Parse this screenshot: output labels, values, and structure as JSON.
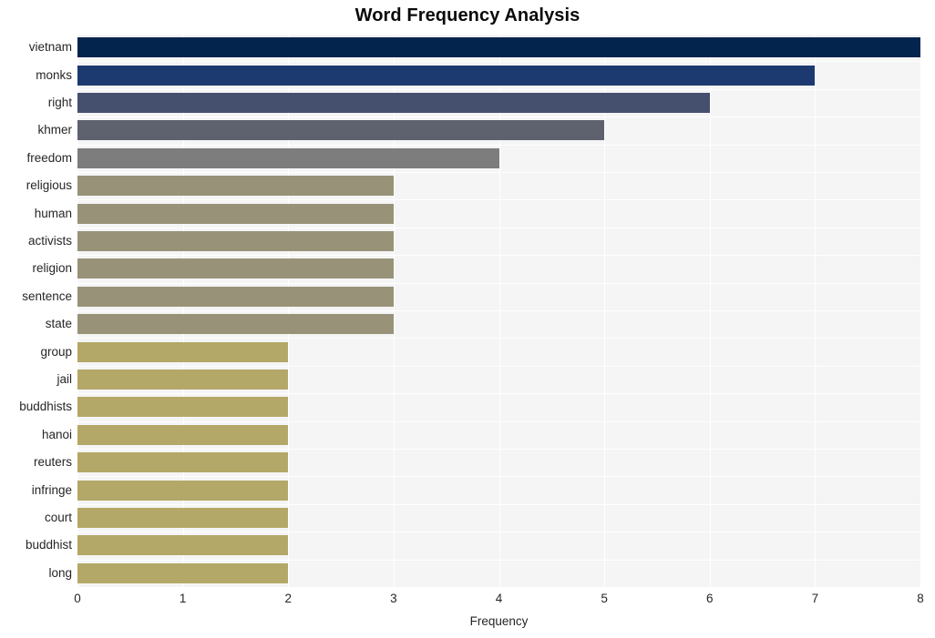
{
  "chart_data": {
    "type": "bar",
    "orientation": "horizontal",
    "title": "Word Frequency Analysis",
    "xlabel": "Frequency",
    "ylabel": "",
    "xlim": [
      0,
      8
    ],
    "xticks": [
      "0",
      "1",
      "2",
      "3",
      "4",
      "5",
      "6",
      "7",
      "8"
    ],
    "grid": true,
    "legend": false,
    "categories": [
      "vietnam",
      "monks",
      "right",
      "khmer",
      "freedom",
      "religious",
      "human",
      "activists",
      "religion",
      "sentence",
      "state",
      "group",
      "jail",
      "buddhists",
      "hanoi",
      "reuters",
      "infringe",
      "court",
      "buddhist",
      "long"
    ],
    "values": [
      8,
      7,
      6,
      5,
      4,
      3,
      3,
      3,
      3,
      3,
      3,
      2,
      2,
      2,
      2,
      2,
      2,
      2,
      2,
      2
    ],
    "bar_colors": [
      "#03244d",
      "#1d3a70",
      "#454f6e",
      "#5e626f",
      "#7d7d7d",
      "#989278",
      "#989278",
      "#989278",
      "#989278",
      "#989278",
      "#989278",
      "#b3a867",
      "#b3a867",
      "#b3a867",
      "#b3a867",
      "#b3a867",
      "#b3a867",
      "#b3a867",
      "#b3a867",
      "#b3a867"
    ],
    "plot_background": "#f5f5f6",
    "figure_background": "#ffffff",
    "gridline_color": "#ffffff",
    "title_color": "#0a0a0a",
    "tick_color": "#262626"
  }
}
